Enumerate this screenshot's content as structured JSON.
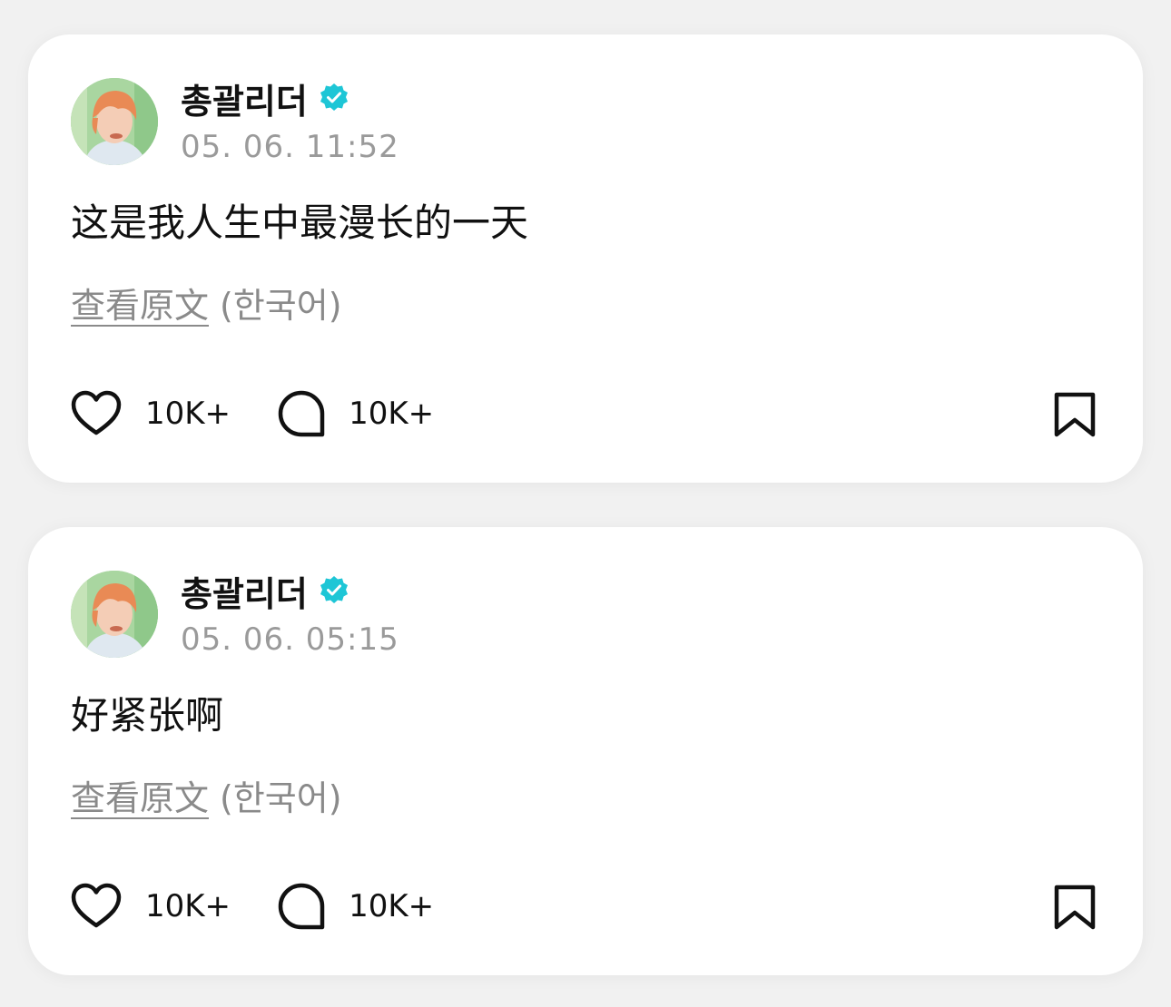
{
  "colors": {
    "background": "#f1f1f1",
    "card": "#ffffff",
    "verified": "#1ec6d6",
    "timestamp": "#9a9a9a",
    "text": "#111111"
  },
  "icons": {
    "like": "heart-outline-icon",
    "comment": "speech-bubble-outline-icon",
    "bookmark": "bookmark-outline-icon",
    "verified": "verified-badge-icon"
  },
  "posts": [
    {
      "author": "총괄리더",
      "timestamp": "05. 06. 11:52",
      "text": "这是我人生中最漫长的一天",
      "translate_link": "查看原文",
      "translate_lang": "(한국어)",
      "likes": "10K+",
      "comments": "10K+"
    },
    {
      "author": "총괄리더",
      "timestamp": "05. 06. 05:15",
      "text": "好紧张啊",
      "translate_link": "查看原文",
      "translate_lang": "(한국어)",
      "likes": "10K+",
      "comments": "10K+"
    }
  ]
}
